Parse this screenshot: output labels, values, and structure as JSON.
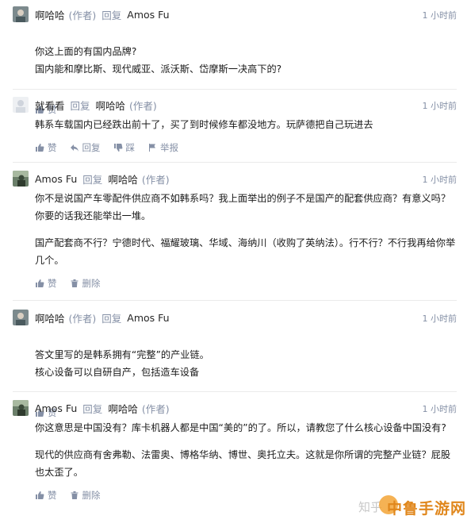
{
  "comments": [
    {
      "author": "啊哈哈",
      "role": "(作者)",
      "reply_word": "回复",
      "reply_to": "Amos Fu",
      "reply_to_role": "",
      "time": "1 小时前",
      "paragraphs": [
        "你这上面的有国内品牌?\n国内能和摩比斯、现代威亚、派沃斯、岱摩斯一决高下的?"
      ],
      "actions": [
        "赞"
      ]
    },
    {
      "author": "就看看",
      "role": "",
      "reply_word": "回复",
      "reply_to": "啊哈哈",
      "reply_to_role": "(作者)",
      "time": "1 小时前",
      "paragraphs": [
        "韩系车载国内已经跌出前十了，买了到时候修车都没地方。玩萨德把自己玩进去"
      ],
      "actions": [
        "赞",
        "回复",
        "踩",
        "举报"
      ]
    },
    {
      "author": "Amos Fu",
      "role": "",
      "reply_word": "回复",
      "reply_to": "啊哈哈",
      "reply_to_role": "(作者)",
      "time": "1 小时前",
      "paragraphs": [
        "你不是说国产车零配件供应商不如韩系吗？我上面举出的例子不是国产的配套供应商？有意义吗？你要的话我还能举出一堆。",
        "国产配套商不行？宁德时代、福耀玻璃、华域、海纳川（收购了英纳法）。行不行？不行我再给你举几个。"
      ],
      "actions": [
        "赞",
        "删除"
      ]
    },
    {
      "author": "啊哈哈",
      "role": "(作者)",
      "reply_word": "回复",
      "reply_to": "Amos Fu",
      "reply_to_role": "",
      "time": "1 小时前",
      "paragraphs": [
        "答文里写的是韩系拥有“完整”的产业链。\n核心设备可以自研自产，包括造车设备"
      ],
      "actions": [
        "赞"
      ]
    },
    {
      "author": "Amos Fu",
      "role": "",
      "reply_word": "回复",
      "reply_to": "啊哈哈",
      "reply_to_role": "(作者)",
      "time": "1 小时前",
      "paragraphs": [
        "你这意思是中国没有？库卡机器人都是中国“美的”的了。所以，请教您了什么核心设备中国没有?",
        "现代的供应商有舍弗勒、法雷奥、博格华纳、博世、奥托立夫。这就是你所谓的完整产业链？屁股也太歪了。"
      ],
      "actions": [
        "赞",
        "删除"
      ]
    }
  ],
  "watermark": "知乎",
  "brand": "中鲁手游网"
}
